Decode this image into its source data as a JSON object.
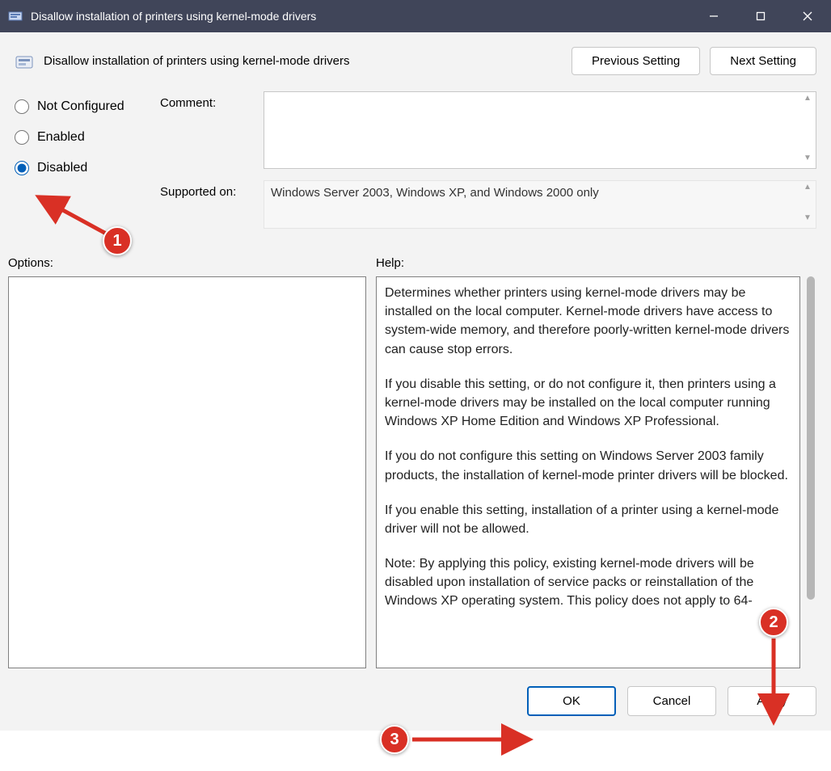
{
  "window": {
    "title": "Disallow installation of printers using kernel-mode drivers"
  },
  "header": {
    "title": "Disallow installation of printers using kernel-mode drivers",
    "previous": "Previous Setting",
    "next": "Next Setting"
  },
  "state": {
    "options": [
      {
        "id": "not-configured",
        "label": "Not Configured"
      },
      {
        "id": "enabled",
        "label": "Enabled"
      },
      {
        "id": "disabled",
        "label": "Disabled"
      }
    ],
    "selected": "disabled"
  },
  "fields": {
    "comment_label": "Comment:",
    "comment_value": "",
    "supported_label": "Supported on:",
    "supported_value": "Windows Server 2003, Windows XP, and Windows 2000 only"
  },
  "section_labels": {
    "options": "Options:",
    "help": "Help:"
  },
  "help": {
    "p1": "Determines whether printers using kernel-mode drivers may be installed on the local computer.  Kernel-mode drivers have access to system-wide memory, and therefore poorly-written kernel-mode drivers can cause stop errors.",
    "p2": "If you disable this setting, or do not configure it, then printers using a kernel-mode drivers may be installed on the local computer running Windows XP Home Edition and Windows XP Professional.",
    "p3": "If you do not configure this setting on Windows Server 2003 family products, the installation of kernel-mode printer drivers will be blocked.",
    "p4": "If you enable this setting, installation of a printer using a kernel-mode driver will not be allowed.",
    "p5": "Note: By applying this policy, existing kernel-mode drivers will be disabled upon installation of service packs or reinstallation of the Windows XP operating system. This policy does not apply to 64-"
  },
  "buttons": {
    "ok": "OK",
    "cancel": "Cancel",
    "apply": "Apply"
  },
  "annotations": {
    "a1": "1",
    "a2": "2",
    "a3": "3"
  }
}
